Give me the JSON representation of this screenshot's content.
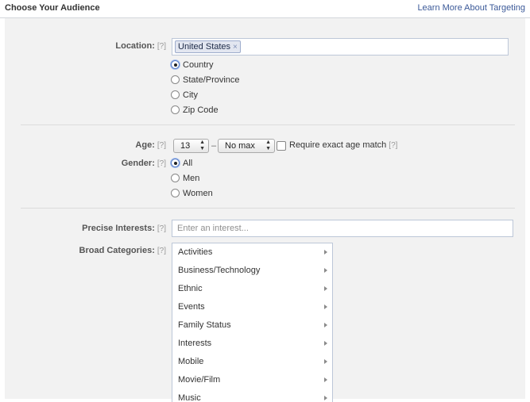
{
  "header": {
    "title": "Choose Your Audience",
    "link": "Learn More About Targeting"
  },
  "help_marker": "[?]",
  "location": {
    "label": "Location:",
    "token": "United States",
    "token_remove": "×",
    "options": [
      {
        "label": "Country",
        "checked": true
      },
      {
        "label": "State/Province",
        "checked": false
      },
      {
        "label": "City",
        "checked": false
      },
      {
        "label": "Zip Code",
        "checked": false
      }
    ]
  },
  "age": {
    "label": "Age:",
    "min": "13",
    "separator": "–",
    "max": "No max",
    "exact_match_label": "Require exact age match"
  },
  "gender": {
    "label": "Gender:",
    "options": [
      {
        "label": "All",
        "checked": true
      },
      {
        "label": "Men",
        "checked": false
      },
      {
        "label": "Women",
        "checked": false
      }
    ]
  },
  "interests": {
    "label": "Precise Interests:",
    "placeholder": "Enter an interest..."
  },
  "categories": {
    "label": "Broad Categories:",
    "items": [
      "Activities",
      "Business/Technology",
      "Ethnic",
      "Events",
      "Family Status",
      "Interests",
      "Mobile",
      "Movie/Film",
      "Music"
    ]
  },
  "icons": {
    "select_arrows": "updown-arrows-icon",
    "category_arrow": "chevron-right-icon"
  }
}
